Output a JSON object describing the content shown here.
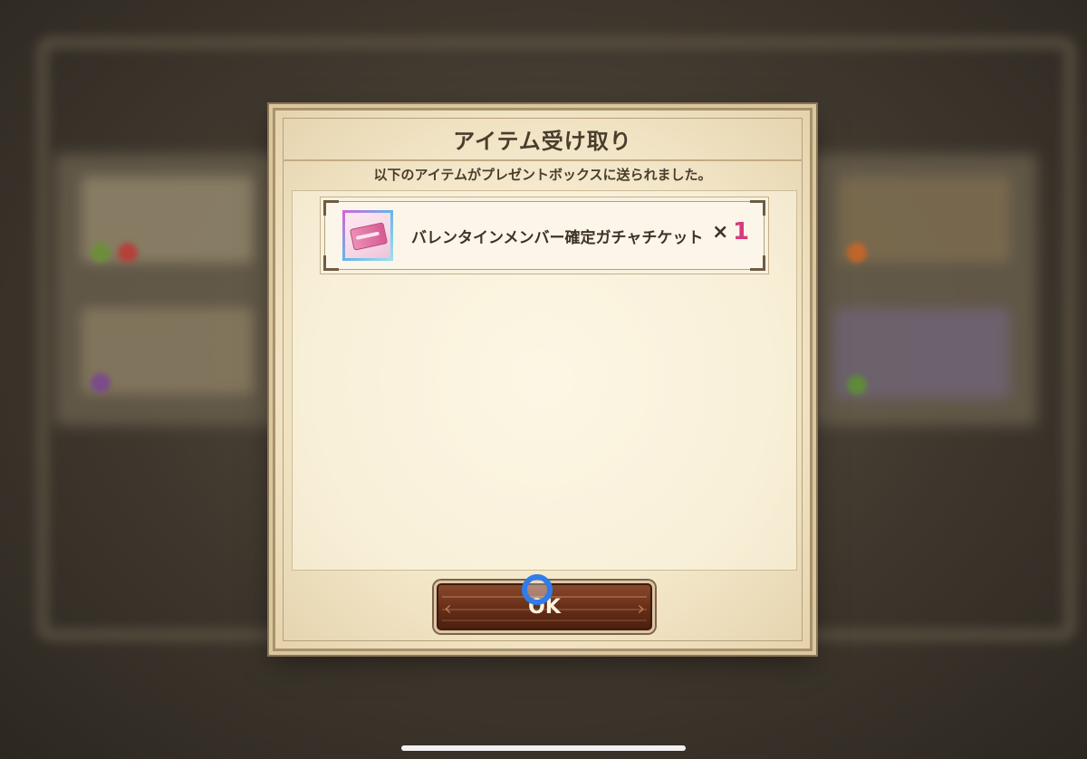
{
  "dialog": {
    "title": "アイテム受け取り",
    "message": "以下のアイテムがプレゼントボックスに送られました。",
    "items": [
      {
        "name": "バレンタインメンバー確定ガチャチケット",
        "times_symbol": "×",
        "quantity": "1",
        "icon": "gacha-ticket-icon"
      }
    ],
    "ok_label": "OK"
  },
  "colors": {
    "quantity": "#d83a7c",
    "button": "#6a2f18",
    "touch_indicator": "#2f7de9"
  }
}
